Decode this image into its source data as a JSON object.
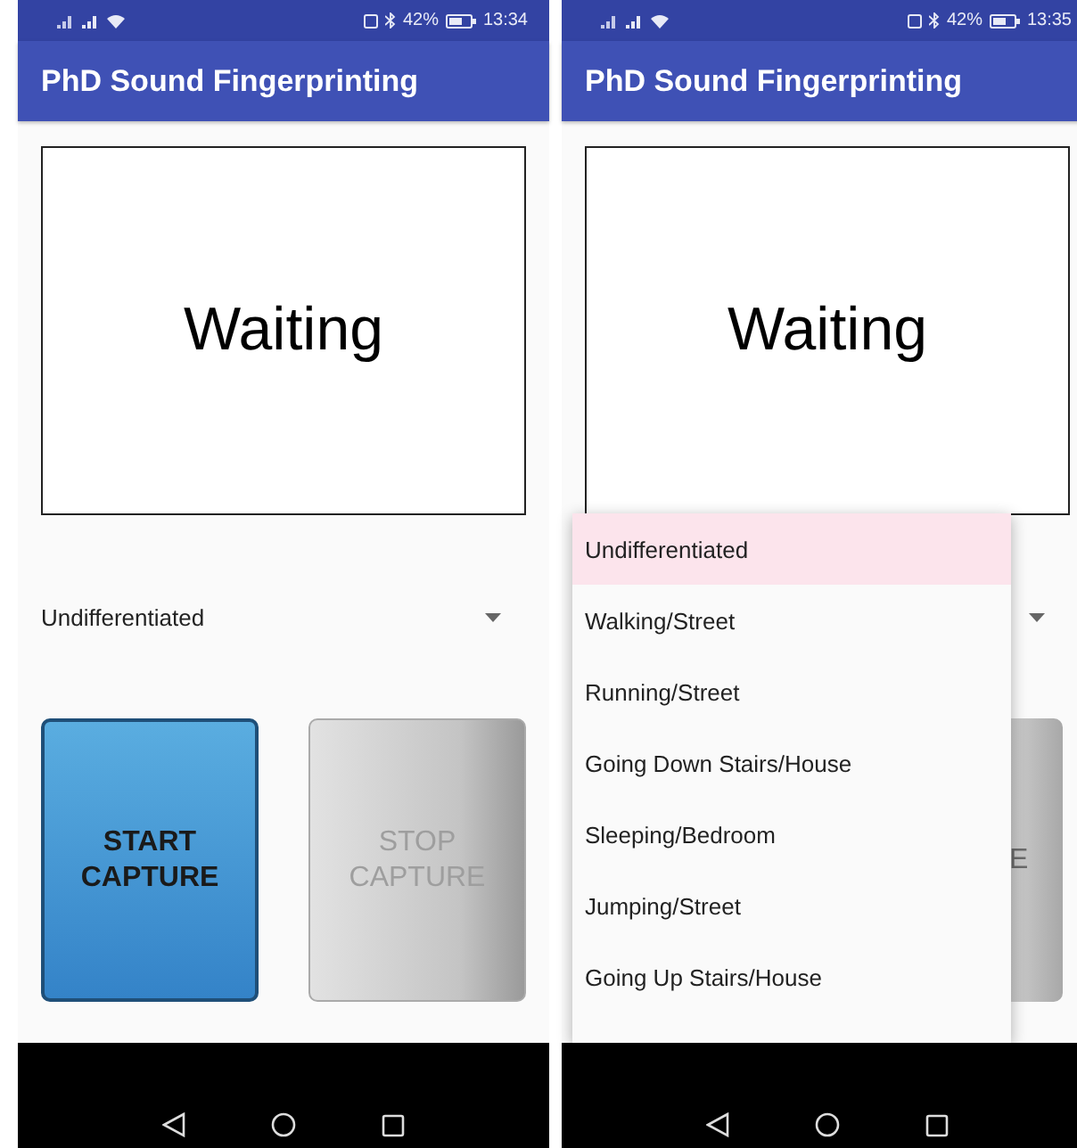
{
  "screens": [
    {
      "status_bar": {
        "battery": "42%",
        "time": "13:34"
      },
      "app_bar": {
        "title": "PhD Sound Fingerprinting"
      },
      "display": {
        "text": "Waiting"
      },
      "activity_spinner": {
        "value": "Undifferentiated",
        "open": false
      },
      "buttons": [
        {
          "label": "START CAPTURE",
          "enabled": true
        },
        {
          "label": "STOP CAPTURE",
          "enabled": false
        }
      ]
    },
    {
      "status_bar": {
        "battery": "42%",
        "time": "13:35"
      },
      "app_bar": {
        "title": "PhD Sound Fingerprinting"
      },
      "display": {
        "text": "Waiting"
      },
      "activity_spinner": {
        "open": true,
        "options": [
          {
            "label": "Undifferentiated",
            "selected": true
          },
          {
            "label": "Walking/Street",
            "selected": false
          },
          {
            "label": "Running/Street",
            "selected": false
          },
          {
            "label": "Going Down Stairs/House",
            "selected": false
          },
          {
            "label": "Sleeping/Bedroom",
            "selected": false
          },
          {
            "label": "Jumping/Street",
            "selected": false
          },
          {
            "label": "Going Up Stairs/House",
            "selected": false
          }
        ]
      },
      "stop_button_edge": {
        "label": "E"
      }
    }
  ]
}
